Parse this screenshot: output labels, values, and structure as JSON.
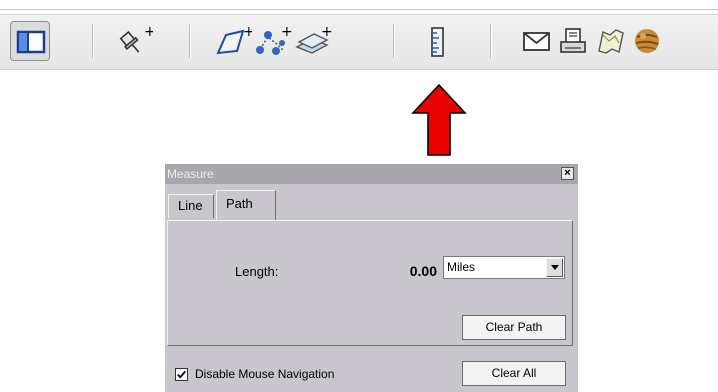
{
  "toolbar": {
    "icons": [
      "sidebar-toggle-icon",
      "add-placemark-icon",
      "add-polygon-icon",
      "add-path-icon",
      "add-image-overlay-icon",
      "ruler-icon",
      "email-icon",
      "print-icon",
      "map-icon",
      "planet-icon"
    ]
  },
  "dialog": {
    "title": "Measure",
    "close_label": "×",
    "tabs": {
      "line": "Line",
      "path": "Path"
    },
    "length_label": "Length:",
    "length_value": "0.00",
    "unit_selected": "Miles",
    "clear_path_label": "Clear Path",
    "disable_nav_label": "Disable Mouse Navigation",
    "disable_nav_checked": true,
    "clear_all_label": "Clear All"
  },
  "colors": {
    "dialog_bg": "#c9c6ce",
    "titlebar_bg": "#a9a6ad",
    "arrow": "#e60000"
  }
}
